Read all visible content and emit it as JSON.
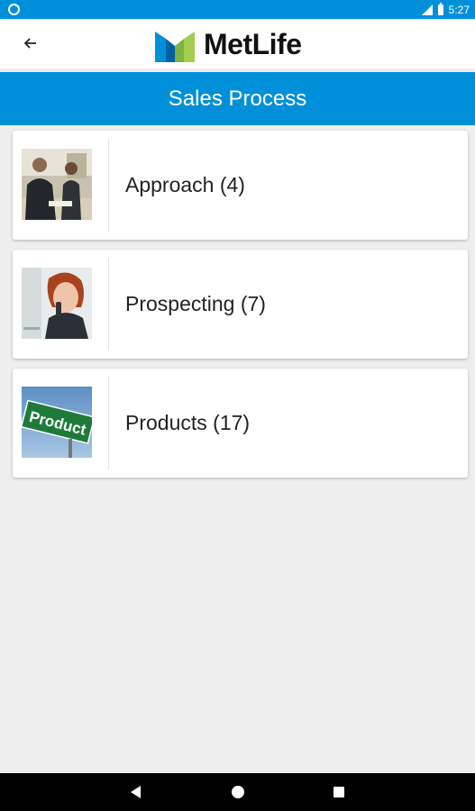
{
  "status_bar": {
    "time": "5:27",
    "left_icon": "circle-notification-icon",
    "icons": [
      "signal-icon",
      "battery-icon"
    ]
  },
  "header": {
    "back_icon": "arrow-left-icon",
    "brand_name": "MetLife",
    "brand_colors": {
      "blue": "#0090da",
      "green": "#a4ce4e",
      "dark_blue": "#0061a0"
    }
  },
  "title_bar": {
    "title": "Sales Process",
    "background": "#0090da"
  },
  "items": [
    {
      "label": "Approach (4)",
      "thumbnail": "business-meeting-photo"
    },
    {
      "label": "Prospecting (7)",
      "thumbnail": "woman-on-phone-photo"
    },
    {
      "label": "Products (17)",
      "thumbnail": "product-road-sign-photo",
      "sign_text": "Product"
    }
  ],
  "nav_bar": {
    "icons": [
      "nav-back-icon",
      "nav-home-icon",
      "nav-recents-icon"
    ]
  }
}
